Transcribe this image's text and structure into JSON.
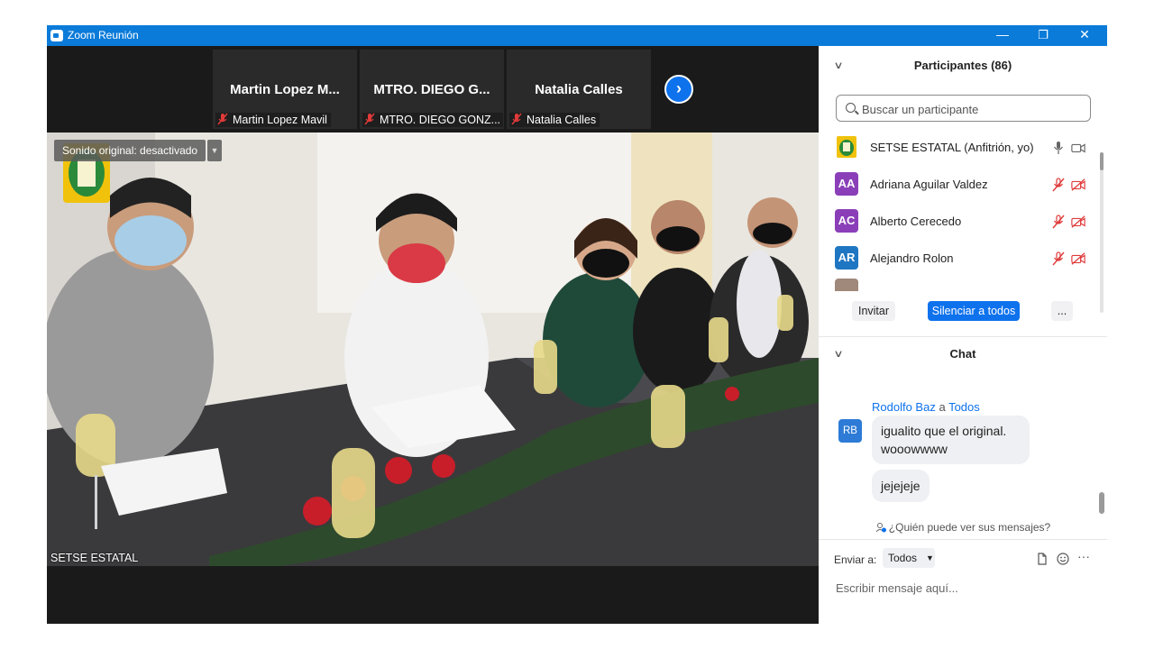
{
  "window": {
    "title": "Zoom Reunión",
    "controls": {
      "minimize": "—",
      "restore": "❐",
      "close": "✕"
    }
  },
  "colors": {
    "titlebar": "#0b7bd9",
    "accent": "#0e72ed",
    "muted_red": "#e03a3a",
    "avatar_purple": "#8a3fb8",
    "avatar_blue": "#1f76c2"
  },
  "video_strip": {
    "tiles": [
      {
        "display_name": "Martin  Lopez  M...",
        "footer_name": "Martin Lopez Mavil",
        "muted": true
      },
      {
        "display_name": "MTRO. DIEGO G...",
        "footer_name": "MTRO. DIEGO GONZ...",
        "muted": true
      },
      {
        "display_name": "Natalia Calles",
        "footer_name": "Natalia Calles",
        "muted": true
      }
    ],
    "next_icon": "chevron-right-icon"
  },
  "main_video": {
    "original_sound": "Sonido original: desactivado",
    "speaker_name": "SETSE ESTATAL"
  },
  "participants": {
    "header": "Participantes (86)",
    "search_placeholder": "Buscar un participante",
    "list": [
      {
        "initials": "",
        "name": "SETSE ESTATAL (Anfitrión, yo)",
        "mic": "on",
        "video": "on"
      },
      {
        "initials": "AA",
        "name": "Adriana Aguilar Valdez",
        "mic": "muted",
        "video": "off"
      },
      {
        "initials": "AC",
        "name": "Alberto Cerecedo",
        "mic": "muted",
        "video": "off"
      },
      {
        "initials": "AR",
        "name": "Alejandro Rolon",
        "mic": "muted",
        "video": "off"
      }
    ],
    "buttons": {
      "invite": "Invitar",
      "mute_all": "Silenciar a todos",
      "more": "..."
    }
  },
  "chat": {
    "header": "Chat",
    "sender_from": "Rodolfo Baz",
    "sender_sep": "a",
    "sender_to": "Todos",
    "sender_initials": "RB",
    "messages": [
      {
        "line1": "igualito que el original.",
        "line2": "wooowwww"
      },
      {
        "line1": "jejejeje"
      }
    ],
    "who_can_see": "¿Quién puede ver sus mensajes?",
    "send_to_label": "Enviar a:",
    "send_to_value": "Todos",
    "compose_placeholder": "Escribir mensaje aquí...",
    "more_tools": "···"
  }
}
